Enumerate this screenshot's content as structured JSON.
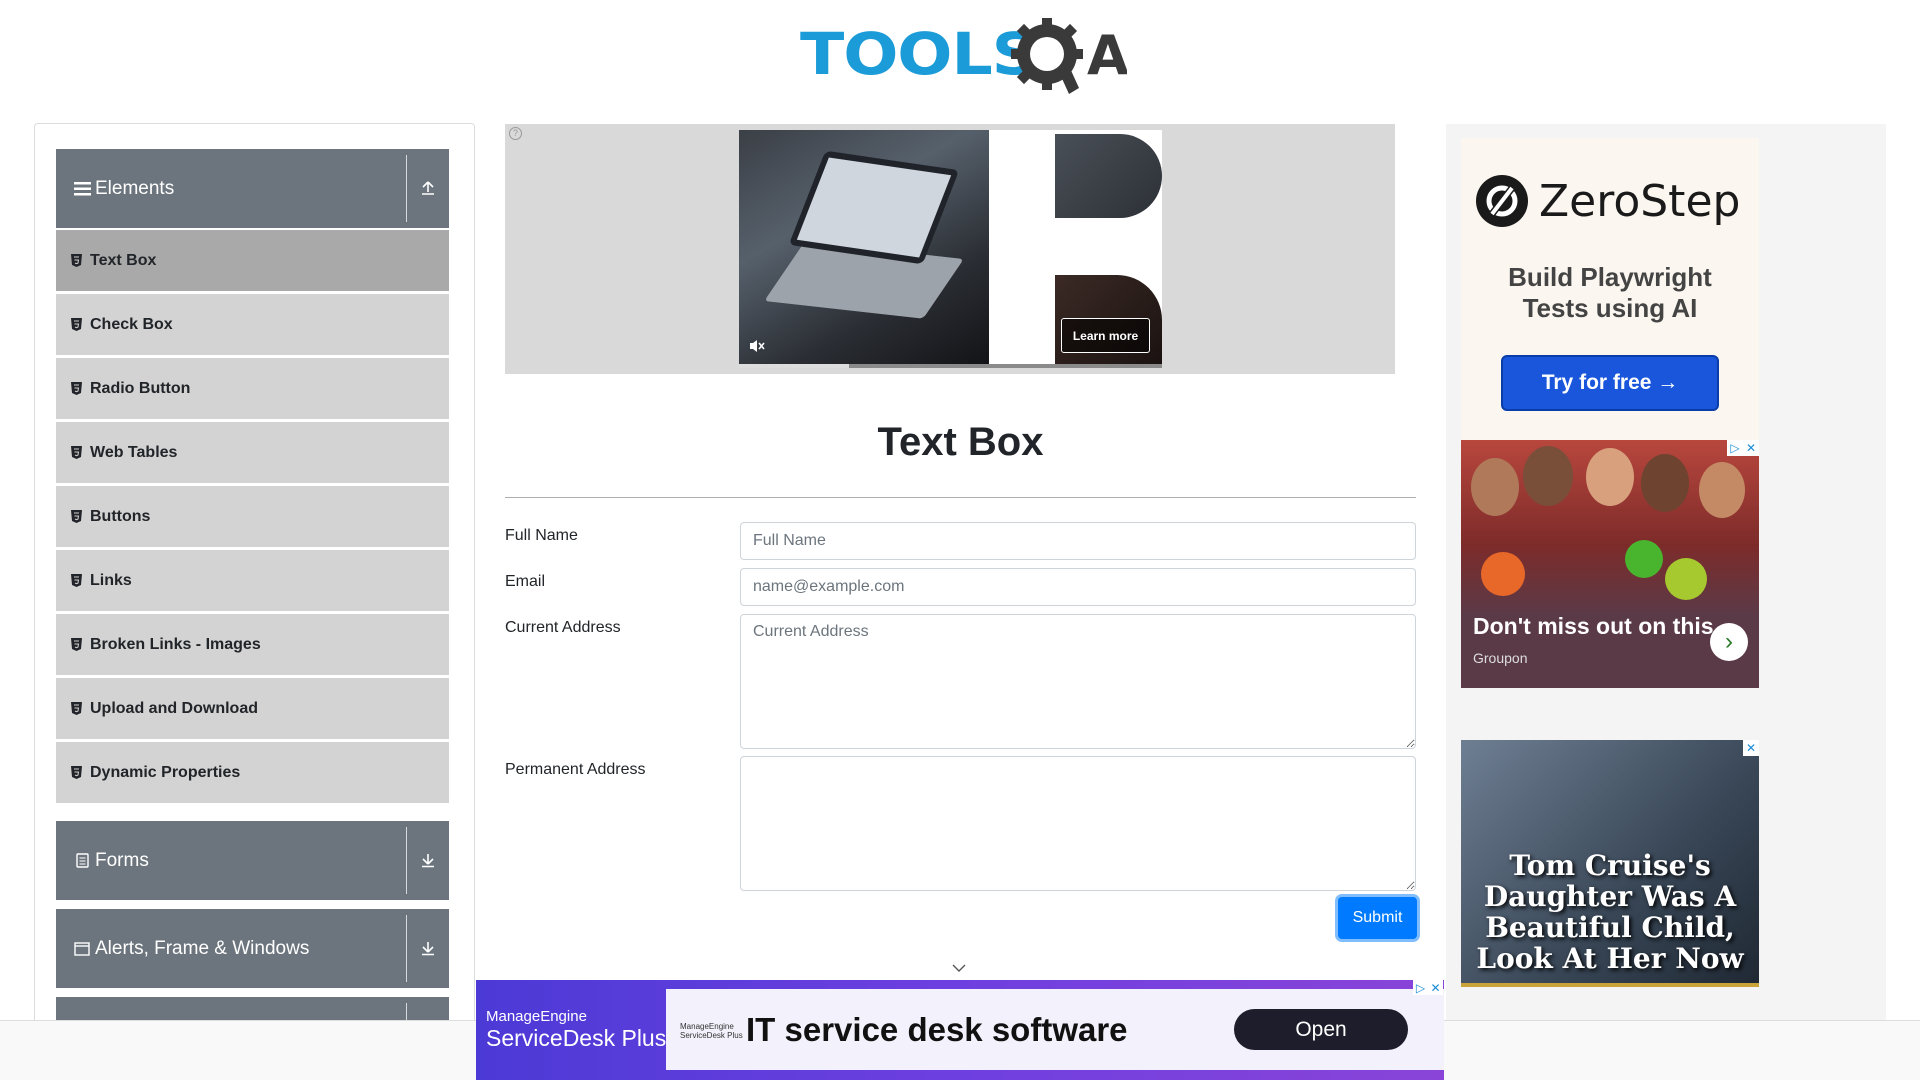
{
  "header": {
    "logo_text": "TOOLS",
    "logo_suffix": "A"
  },
  "sidebar": {
    "groups": [
      {
        "title": "Elements",
        "icon": "hamburger-icon",
        "expanded": true
      },
      {
        "title": "Forms",
        "icon": "document-icon",
        "expanded": false
      },
      {
        "title": "Alerts, Frame & Windows",
        "icon": "window-icon",
        "expanded": false
      }
    ],
    "items": [
      {
        "label": "Text Box",
        "active": true
      },
      {
        "label": "Check Box"
      },
      {
        "label": "Radio Button"
      },
      {
        "label": "Web Tables"
      },
      {
        "label": "Buttons"
      },
      {
        "label": "Links"
      },
      {
        "label": "Broken Links - Images"
      },
      {
        "label": "Upload and Download"
      },
      {
        "label": "Dynamic Properties"
      }
    ]
  },
  "top_ad": {
    "learn_more": "Learn more",
    "progress": 0.26
  },
  "main": {
    "title": "Text Box",
    "fields": {
      "full_name": {
        "label": "Full Name",
        "placeholder": "Full Name",
        "value": ""
      },
      "email": {
        "label": "Email",
        "placeholder": "name@example.com",
        "value": ""
      },
      "current_address": {
        "label": "Current Address",
        "placeholder": "Current Address",
        "value": ""
      },
      "permanent_address": {
        "label": "Permanent Address",
        "placeholder": "",
        "value": ""
      }
    },
    "submit_label": "Submit"
  },
  "right_ads": {
    "zerostep": {
      "brand": "ZeroStep",
      "tagline_line1": "Build Playwright",
      "tagline_line2": "Tests using AI",
      "cta": "Try for free →"
    },
    "groupon": {
      "caption": "Don't miss out on this",
      "source": "Groupon"
    },
    "tabloid": {
      "caption_line1": "Tom Cruise's",
      "caption_line2": "Daughter Was A",
      "caption_line3": "Beautiful Child,",
      "caption_line4": "Look At Her Now"
    }
  },
  "bottom_ad": {
    "brand_line1": "ManageEngine",
    "brand_line2": "ServiceDesk Plus",
    "mini_line1": "ManageEngine",
    "mini_line2": "ServiceDesk Plus",
    "headline": "IT service desk software",
    "cta": "Open"
  },
  "colors": {
    "brand_blue": "#1b9bd7",
    "group_header": "#6c757d",
    "menu_item": "#d3d3d3",
    "menu_active": "#a9a9a9",
    "submit": "#007bff"
  }
}
